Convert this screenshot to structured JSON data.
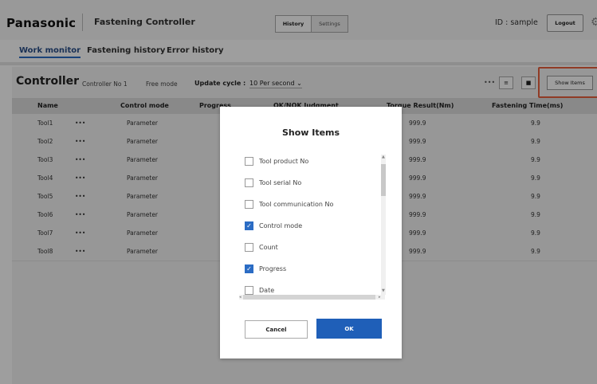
{
  "header": {
    "logo": "Panasonic",
    "title": "Fastening Controller",
    "history_label": "History",
    "settings_label": "Settings",
    "user_id": "ID : sample",
    "logout_label": "Logout"
  },
  "tabs": [
    "Work monitor",
    "Fastening history",
    "Error history"
  ],
  "controller": {
    "title": "Controller",
    "number": "Controller No 1",
    "mode": "Free mode",
    "update_label": "Update cycle :",
    "update_value": "10 Per second",
    "more": "•••",
    "show_items_label": "Show Items"
  },
  "table": {
    "headers": [
      "Name",
      "Control mode",
      "Progress",
      "OK/NOK Judgment",
      "Torque Result(Nm)",
      "Fastening Time(ms)"
    ],
    "rows": [
      {
        "name": "Tool1",
        "dots": "•••",
        "mode": "Parameter",
        "torque": "999.9",
        "time": "9.9"
      },
      {
        "name": "Tool2",
        "dots": "•••",
        "mode": "Parameter",
        "torque": "999.9",
        "time": "9.9"
      },
      {
        "name": "Tool3",
        "dots": "•••",
        "mode": "Parameter",
        "torque": "999.9",
        "time": "9.9"
      },
      {
        "name": "Tool4",
        "dots": "•••",
        "mode": "Parameter",
        "torque": "999.9",
        "time": "9.9"
      },
      {
        "name": "Tool5",
        "dots": "•••",
        "mode": "Parameter",
        "torque": "999.9",
        "time": "9.9"
      },
      {
        "name": "Tool6",
        "dots": "•••",
        "mode": "Parameter",
        "torque": "999.9",
        "time": "9.9"
      },
      {
        "name": "Tool7",
        "dots": "•••",
        "mode": "Parameter",
        "torque": "999.9",
        "time": "9.9"
      },
      {
        "name": "Tool8",
        "dots": "•••",
        "mode": "Parameter",
        "torque": "999.9",
        "time": "9.9"
      }
    ]
  },
  "dialog": {
    "title": "Show Items",
    "items": [
      {
        "label": "Tool product No",
        "checked": false
      },
      {
        "label": "Tool serial No",
        "checked": false
      },
      {
        "label": "Tool communication No",
        "checked": false
      },
      {
        "label": "Control mode",
        "checked": true
      },
      {
        "label": "Count",
        "checked": false
      },
      {
        "label": "Progress",
        "checked": true
      },
      {
        "label": "Date",
        "checked": false
      }
    ],
    "cancel_label": "Cancel",
    "ok_label": "OK"
  },
  "colors": {
    "accent": "#1f5fb8",
    "highlight": "#e8603c"
  }
}
